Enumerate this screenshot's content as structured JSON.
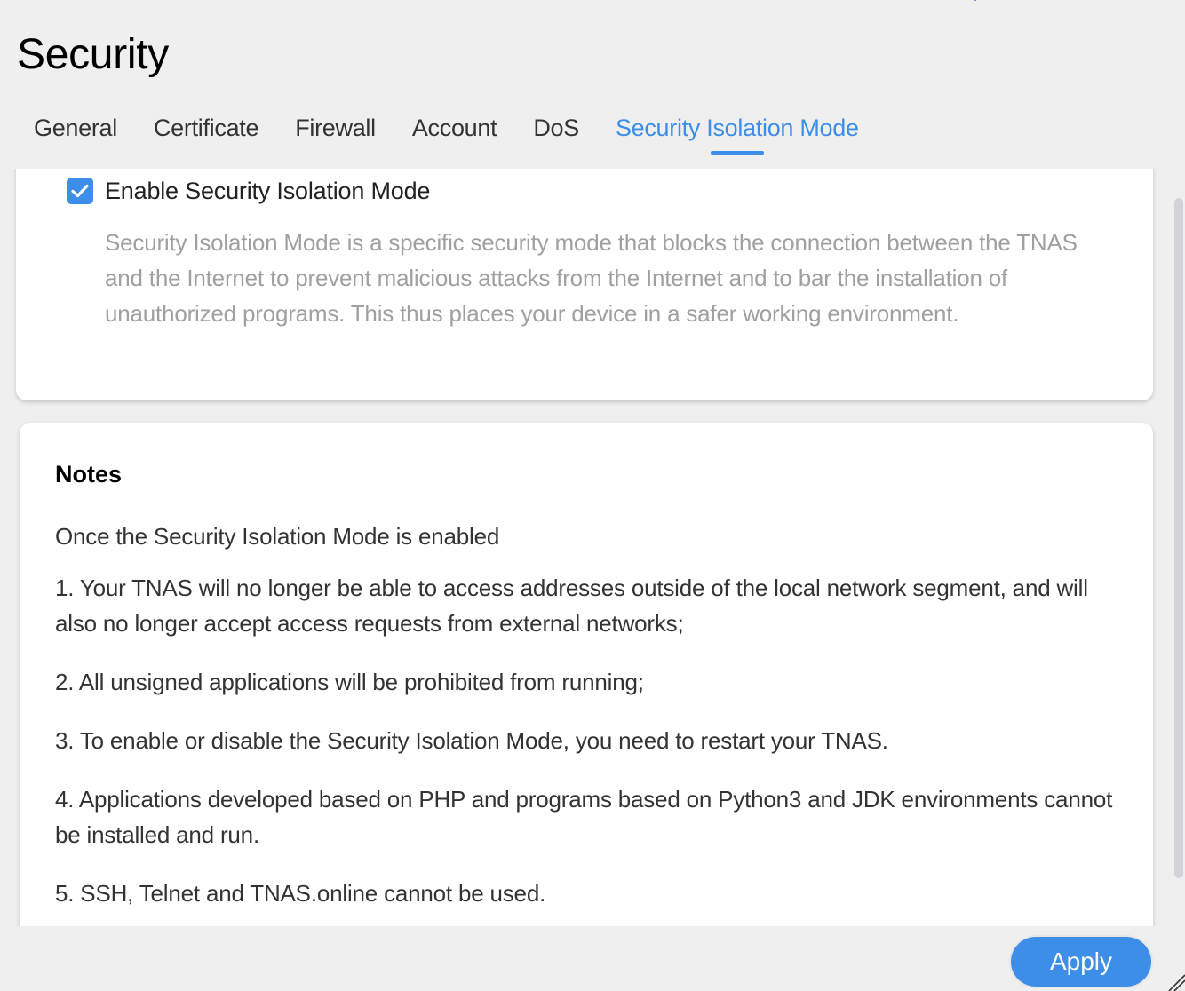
{
  "page": {
    "title": "Security"
  },
  "tabs": [
    {
      "label": "General",
      "active": false
    },
    {
      "label": "Certificate",
      "active": false
    },
    {
      "label": "Firewall",
      "active": false
    },
    {
      "label": "Account",
      "active": false
    },
    {
      "label": "DoS",
      "active": false
    },
    {
      "label": "Security Isolation Mode",
      "active": true
    }
  ],
  "enable_card": {
    "checkbox_checked": true,
    "checkbox_icon": "checkmark-icon",
    "label": "Enable Security Isolation Mode",
    "description": "Security Isolation Mode is a specific security mode that blocks the connection between the TNAS and the Internet to prevent malicious attacks from the Internet and to bar the installation of unauthorized programs. This thus places your device in a safer working environment."
  },
  "notes_card": {
    "title": "Notes",
    "intro": "Once the Security Isolation Mode is enabled",
    "items": [
      "1. Your TNAS will no longer be able to access addresses outside of the local network segment, and will also no longer accept access requests from external networks;",
      "2. All unsigned applications will be prohibited from running;",
      "3. To enable or disable the Security Isolation Mode, you need to restart your TNAS.",
      "4. Applications developed based on PHP and programs based on Python3 and JDK environments cannot be installed and run.",
      "5. SSH, Telnet and TNAS.online cannot be used."
    ]
  },
  "footer": {
    "apply_label": "Apply"
  },
  "colors": {
    "accent": "#3d8ee8",
    "background": "#efefef",
    "card": "#ffffff",
    "muted_text": "#a0a0a0",
    "body_text": "#333333"
  }
}
